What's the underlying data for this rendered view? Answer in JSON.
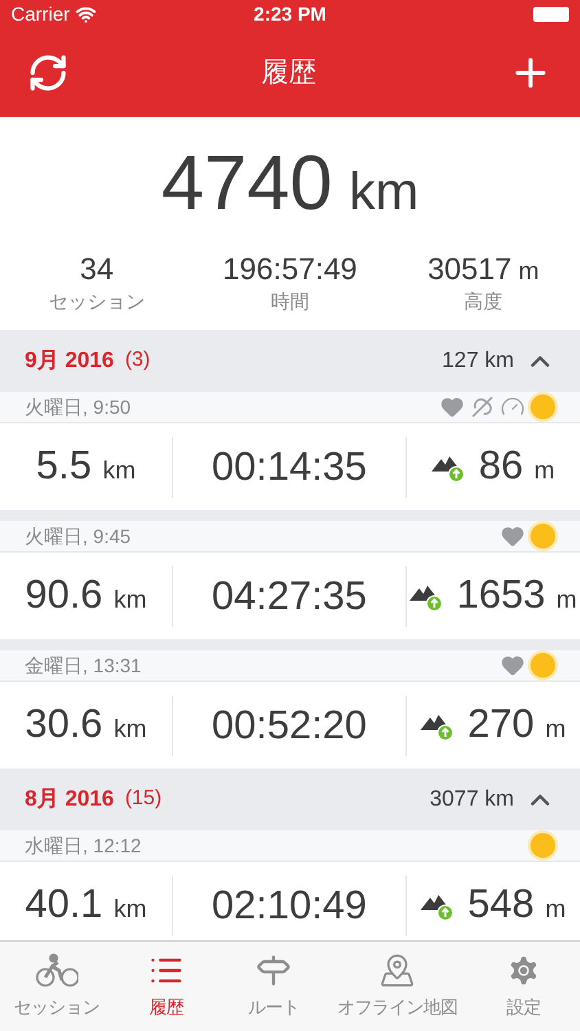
{
  "status_bar": {
    "carrier": "Carrier",
    "time": "2:23 PM"
  },
  "nav": {
    "title": "履歴"
  },
  "summary": {
    "distance": "4740",
    "distance_unit": "km",
    "stats": [
      {
        "value": "34",
        "label": "セッション"
      },
      {
        "value": "196:57:49",
        "label": "時間"
      },
      {
        "value": "30517",
        "unit": "m",
        "label": "高度"
      }
    ]
  },
  "months": [
    {
      "title": "9月 2016",
      "count": "(3)",
      "distance": "127 km",
      "expanded": true,
      "sessions": [
        {
          "day": "火曜日, 9:50",
          "icons": [
            {
              "kind": "heart"
            },
            {
              "kind": "route"
            },
            {
              "kind": "gauge"
            },
            {
              "kind": "sun"
            }
          ],
          "distance": "5.5",
          "distance_unit": "km",
          "duration": "00:14:35",
          "ascent": "86",
          "ascent_unit": "m"
        },
        {
          "day": "火曜日, 9:45",
          "icons": [
            {
              "kind": "heart"
            },
            {
              "kind": "sun"
            }
          ],
          "distance": "90.6",
          "distance_unit": "km",
          "duration": "04:27:35",
          "ascent": "1653",
          "ascent_unit": "m"
        },
        {
          "day": "金曜日, 13:31",
          "icons": [
            {
              "kind": "heart"
            },
            {
              "kind": "sun"
            }
          ],
          "distance": "30.6",
          "distance_unit": "km",
          "duration": "00:52:20",
          "ascent": "270",
          "ascent_unit": "m"
        }
      ]
    },
    {
      "title": "8月 2016",
      "count": "(15)",
      "distance": "3077 km",
      "expanded": true,
      "sessions": [
        {
          "day": "水曜日, 12:12",
          "icons": [
            {
              "kind": "sun"
            }
          ],
          "distance": "40.1",
          "distance_unit": "km",
          "duration": "02:10:49",
          "ascent": "548",
          "ascent_unit": "m"
        }
      ]
    }
  ],
  "tabs": [
    {
      "kind": "sessions",
      "label": "セッション",
      "selected": false
    },
    {
      "kind": "history",
      "label": "履歴",
      "selected": true
    },
    {
      "kind": "routes",
      "label": "ルート",
      "selected": false
    },
    {
      "kind": "offline_maps",
      "label": "オフライン地図",
      "selected": false
    },
    {
      "kind": "settings",
      "label": "設定",
      "selected": false
    }
  ]
}
